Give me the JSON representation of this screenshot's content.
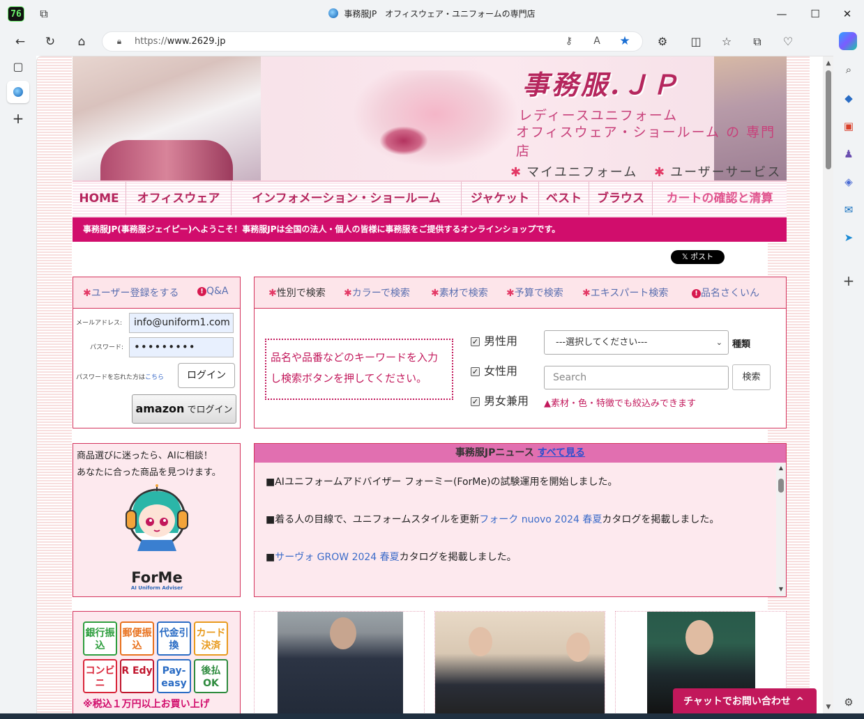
{
  "window": {
    "title": "事務服JP　オフィスウェア・ユニフォームの専門店",
    "app_badge": "76"
  },
  "address_bar": {
    "url_prefix": "https://",
    "url_host": "www.2629.jp"
  },
  "site": {
    "brand": "事務服.ＪＰ",
    "tagline1": "レディースユニフォーム",
    "tagline2": "オフィスウェア・ショールーム の 専門店",
    "my_uniform": "マイユニフォーム",
    "user_service": "ユーザーサービス"
  },
  "menu": [
    "HOME",
    "オフィスウェア",
    "インフォメーション・ショールーム",
    "ジャケット",
    "ベスト",
    "ブラウス",
    "カートの確認と清算"
  ],
  "welcome": "事務服JP(事務服ジェイピー)へようこそ！事務服JPは全国の法人・個人の皆様に事務服をご提供するオンラインショップです。",
  "social": {
    "x_post": "𝕏 ポスト"
  },
  "login": {
    "register": "ユーザー登録をする",
    "qa": "Q&A",
    "email_label": "メールアドレス:",
    "email_value": "info@uniform1.com",
    "password_label": "パスワード:",
    "password_value": "•••••••••",
    "forgot_prefix": "パスワードを忘れた方は",
    "forgot_link": "こちら",
    "login_button": "ログイン",
    "amazon_word": "amazon",
    "amazon_suffix": "でログイン"
  },
  "search": {
    "tabs": [
      "性別で検索",
      "カラーで検索",
      "素材で検索",
      "予算で検索",
      "エキスパート検索",
      "品名さくいん"
    ],
    "keyword_hint": "品名や品番などのキーワードを入力し検索ボタンを押してください。",
    "genders": [
      {
        "label": "男性用",
        "checked": true
      },
      {
        "label": "女性用",
        "checked": true
      },
      {
        "label": "男女兼用",
        "checked": true
      }
    ],
    "category_select": "---選択してください---",
    "category_label": "種類",
    "search_placeholder": "Search",
    "search_button": "検索",
    "narrow_note": "▲素材・色・特徴でも絞込みできます"
  },
  "ai_advisor": {
    "line1": "商品選びに迷ったら、AIに相談！",
    "line2": "あなたに合った商品を見つけます。",
    "logo": "ForMe",
    "logo_sub": "AI Uniform Adviser"
  },
  "news": {
    "title": "事務服JPニュース",
    "see_all": "すべて見る",
    "items": [
      {
        "prefix": "■AIユニフォームアドバイザー フォーミー(ForMe)の試験運用を開始しました。",
        "link": "",
        "suffix": ""
      },
      {
        "prefix": "■着る人の目線で、ユニフォームスタイルを更新",
        "link": "フォーク nuovo 2024 春夏",
        "suffix": "カタログを掲載しました。"
      },
      {
        "prefix": "■",
        "link": "サーヴォ GROW 2024 春夏",
        "suffix": "カタログを掲載しました。"
      }
    ]
  },
  "payment": {
    "methods": [
      {
        "label": "銀行振込",
        "color": "#2e9e3e"
      },
      {
        "label": "郵便振込",
        "color": "#e8711d"
      },
      {
        "label": "代金引換",
        "color": "#2a6cc4"
      },
      {
        "label": "カード決済",
        "color": "#e89a1d"
      },
      {
        "label": "コンビニ",
        "color": "#d9263a"
      },
      {
        "label": "R Edy",
        "color": "#c0172e"
      },
      {
        "label": "Pay-easy",
        "color": "#2a6cc4"
      },
      {
        "label": "後払OK",
        "color": "#2e8b3e"
      }
    ],
    "note": "※税込１万円以上お買い上げ"
  },
  "chat": {
    "label": "チャットでお問い合わせ",
    "chevron": "^"
  },
  "colors": {
    "brand_pink": "#d10d6c",
    "nav_text": "#b5265d",
    "link_blue": "#5a6fb0"
  }
}
